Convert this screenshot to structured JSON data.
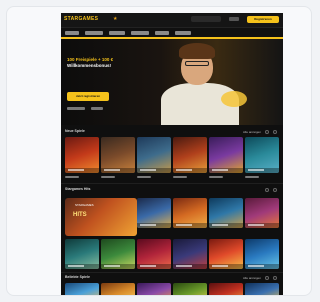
{
  "nav": {
    "logo": "STARGAMES",
    "cta": "Registrieren"
  },
  "hero": {
    "title_a": "100 Freispiele + 100 €",
    "title_b": "Willkommensbonus!",
    "button": "Jetzt registrieren"
  },
  "sections": {
    "top": {
      "title": "Neue Spiele",
      "right": "Alle anzeigen"
    },
    "middle": {
      "title": "Stargames Hits"
    },
    "bottom": {
      "title": "Beliebte Spiele",
      "right": "Alle anzeigen"
    }
  },
  "feature": {
    "caption": "STARGAMES",
    "title": "HITS"
  },
  "colors": {
    "accent": "#f5c21b",
    "background": "#0f0f0f"
  }
}
